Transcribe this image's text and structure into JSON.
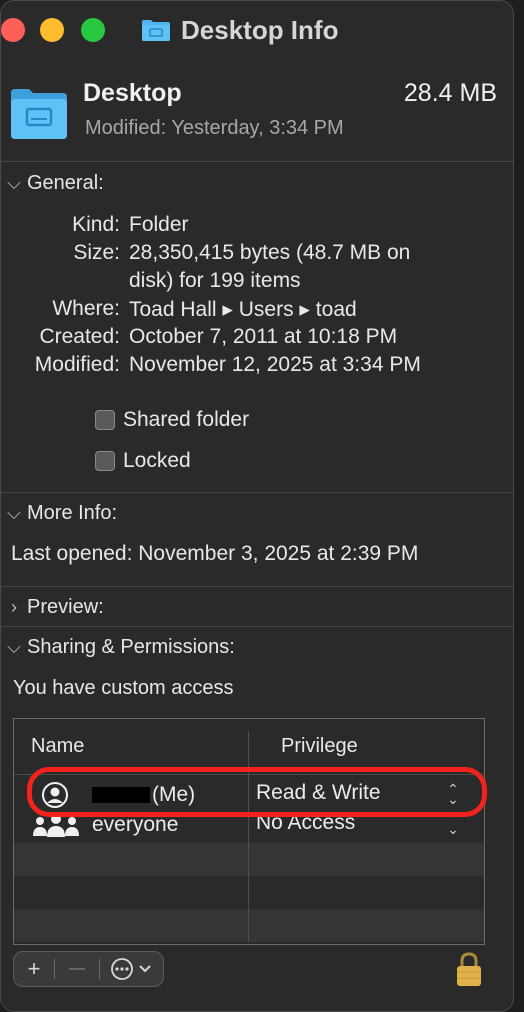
{
  "window": {
    "title": "Desktop Info"
  },
  "header": {
    "name": "Desktop",
    "size": "28.4 MB",
    "modified": "Modified: Yesterday, 3:34 PM"
  },
  "general": {
    "heading": "General:",
    "rows": [
      {
        "label": "Kind:",
        "value": "Folder"
      },
      {
        "label": "Size:",
        "value_line1": "28,350,415 bytes (48.7 MB on",
        "value_line2": "disk) for 199 items"
      },
      {
        "label": "Where:",
        "value": "Toad Hall ▸ Users ▸ toad"
      },
      {
        "label": "Created:",
        "value": "October 7, 2011 at 10:18 PM"
      },
      {
        "label": "Modified:",
        "value": "November 12, 2025 at 3:34 PM"
      }
    ],
    "shared_folder_label": "Shared folder",
    "locked_label": "Locked"
  },
  "more_info": {
    "heading": "More Info:",
    "last_opened": "Last opened: November 3, 2025 at 2:39 PM"
  },
  "preview": {
    "heading": "Preview:"
  },
  "sharing": {
    "heading": "Sharing & Permissions:",
    "access_text": "You have custom access",
    "columns": [
      "Name",
      "Privilege"
    ],
    "rows": [
      {
        "name_suffix": "(Me)",
        "privilege": "Read & Write"
      },
      {
        "name": "everyone",
        "privilege": "No Access"
      }
    ]
  },
  "toolbar": {
    "add": "+",
    "remove": "—",
    "more": "⋯"
  },
  "colors": {
    "highlight": "#f2231d",
    "folder_blue": "#4fb3f0"
  }
}
